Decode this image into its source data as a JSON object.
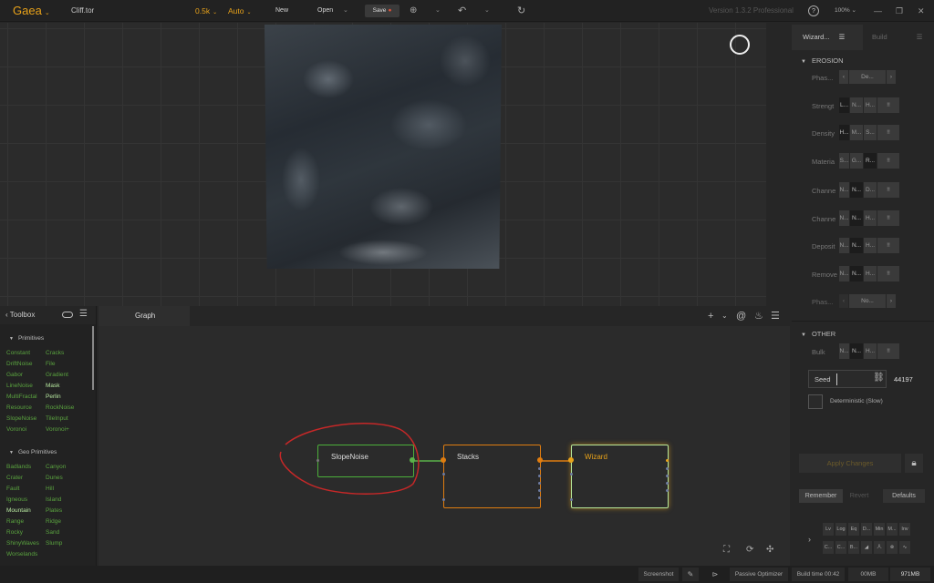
{
  "topbar": {
    "brand": "Gaea",
    "file_name": "Cliff.tor",
    "resolution": "0.5k",
    "build_mode": "Auto",
    "new_label": "New",
    "open_label": "Open",
    "save_label": "Save",
    "version": "Version 1.3.2 Professional",
    "zoom": "100%",
    "accent_color": "#e8a21a"
  },
  "viewport": {
    "tools": [
      "link-icon",
      "pin-icon",
      "2D",
      "sun-icon",
      "cloud-icon",
      "frame-icon",
      "compass-icon",
      "grid-icon"
    ]
  },
  "toolbox": {
    "title": "Toolbox",
    "categories": [
      {
        "name": "Primitives",
        "items": [
          [
            "Constant",
            "Cracks"
          ],
          [
            "DriftNoise",
            "File"
          ],
          [
            "Gabor",
            "Gradient"
          ],
          [
            "LineNoise",
            "Mask"
          ],
          [
            "MultiFractal",
            "Perlin"
          ],
          [
            "Resource",
            "RockNoise"
          ],
          [
            "SlopeNoise",
            "TileInput"
          ],
          [
            "Voronoi",
            "Voronoi+"
          ]
        ]
      },
      {
        "name": "Geo Primitives",
        "items": [
          [
            "Badlands",
            "Canyon"
          ],
          [
            "Crater",
            "Dunes"
          ],
          [
            "Fault",
            "Hill"
          ],
          [
            "Igneous",
            "Island"
          ],
          [
            "Mountain",
            "Plates"
          ],
          [
            "Range",
            "Ridge"
          ],
          [
            "Rocky",
            "Sand"
          ],
          [
            "ShinyWaves",
            "Slump"
          ],
          [
            "Worselands",
            ""
          ]
        ]
      }
    ]
  },
  "graph": {
    "tab": "Graph",
    "nodes": [
      {
        "name": "SlopeNoise",
        "color": "#4caf3a"
      },
      {
        "name": "Stacks",
        "color": "#e07d10"
      },
      {
        "name": "Wizard",
        "color": "#b8e89a"
      }
    ],
    "highlight_color": "#c62828"
  },
  "right_panel": {
    "tabs": [
      "Wizard...",
      "Build"
    ],
    "erosion": {
      "title": "EROSION",
      "phase_label": "Phas...",
      "phase_value": "De...",
      "rows": [
        {
          "label": "Strengt",
          "options": [
            "L...",
            "N...",
            "H...",
            "!!"
          ],
          "on": 0
        },
        {
          "label": "Density",
          "options": [
            "H...",
            "M...",
            "S...",
            "!!"
          ],
          "on": 0
        },
        {
          "label": "Materia",
          "options": [
            "S...",
            "G...",
            "R...",
            "!!"
          ],
          "on": 2
        },
        {
          "label": "Channe",
          "options": [
            "N...",
            "N...",
            "D...",
            "!!"
          ],
          "on": 1
        },
        {
          "label": "Channe",
          "options": [
            "N...",
            "N...",
            "H...",
            "!!"
          ],
          "on": 1
        },
        {
          "label": "Deposit",
          "options": [
            "N...",
            "N...",
            "H...",
            "!!"
          ],
          "on": 1
        },
        {
          "label": "Remove",
          "options": [
            "N...",
            "N...",
            "H...",
            "!!"
          ],
          "on": 1
        }
      ],
      "phase2_label": "Phas...",
      "phase2_value": "No..."
    },
    "other": {
      "title": "OTHER",
      "bulk_label": "Bulk",
      "bulk_options": [
        "N...",
        "N...",
        "H...",
        "!!"
      ],
      "seed_label": "Seed",
      "seed_value": "44197",
      "deterministic_label": "Deterministic (Slow)"
    },
    "apply_label": "Apply Changes",
    "remember_label": "Remember",
    "revert_label": "Revert",
    "defaults_label": "Defaults",
    "mini_row1": [
      "Lv",
      "Log",
      "Eq",
      "D...",
      "Min",
      "M...",
      "Inv"
    ],
    "mini_row2": [
      "C...",
      "C...",
      "B...",
      "◢",
      "人",
      "⊗",
      "∿",
      "▬"
    ]
  },
  "statusbar": {
    "screenshot": "Screenshot",
    "passive": "Passive Optimizer",
    "build_time": "Build time 00:42",
    "mem1": "00MB",
    "mem2": "971MB"
  }
}
